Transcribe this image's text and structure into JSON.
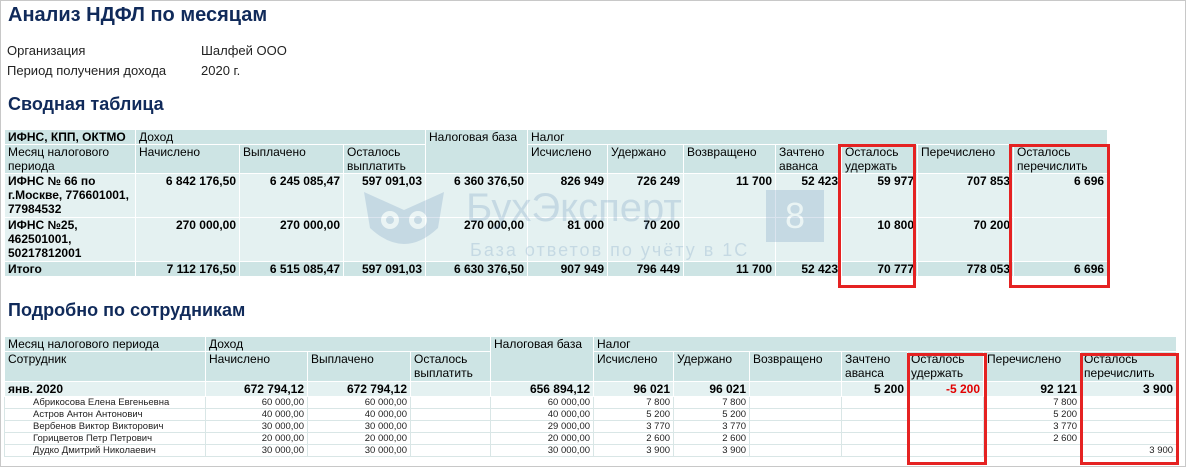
{
  "page": {
    "title": "Анализ НДФЛ по месяцам",
    "org_label": "Организация",
    "org_value": "Шалфей ООО",
    "period_label": "Период получения дохода",
    "period_value": "2020 г."
  },
  "watermark": {
    "title": "БухЭксперт",
    "number": "8",
    "subtitle": "База ответов по учёту в 1С"
  },
  "summary": {
    "heading": "Сводная таблица",
    "h": {
      "group_ifns": "ИФНС, КПП, ОКТМО",
      "group_income": "Доход",
      "tax_base": "Налоговая база",
      "group_tax": "Налог",
      "month": "Месяц налогового периода",
      "accrued": "Начислено",
      "paid": "Выплачено",
      "left_to_pay": "Осталось выплатить",
      "calculated": "Исчислено",
      "withheld": "Удержано",
      "returned": "Возвращено",
      "advance": "Зачтено аванса",
      "left_withhold": "Осталось удержать",
      "transferred": "Перечислено",
      "left_transfer": "Осталось перечислить"
    },
    "rows": [
      {
        "name": "ИФНС № 66 по г.Москве, 776601001, 77984532",
        "accrued": "6 842 176,50",
        "paid": "6 245 085,47",
        "left_to_pay": "597 091,03",
        "tax_base": "6 360 376,50",
        "calculated": "826 949",
        "withheld": "726 249",
        "returned": "11 700",
        "advance": "52 423",
        "left_withhold": "59 977",
        "transferred": "707 853",
        "left_transfer": "6 696"
      },
      {
        "name": "ИФНС №25, 462501001, 50217812001",
        "accrued": "270 000,00",
        "paid": "270 000,00",
        "left_to_pay": "",
        "tax_base": "270 000,00",
        "calculated": "81 000",
        "withheld": "70 200",
        "returned": "",
        "advance": "",
        "left_withhold": "10 800",
        "transferred": "70 200",
        "left_transfer": ""
      }
    ],
    "total": {
      "name": "Итого",
      "accrued": "7 112 176,50",
      "paid": "6 515 085,47",
      "left_to_pay": "597 091,03",
      "tax_base": "6 630 376,50",
      "calculated": "907 949",
      "withheld": "796 449",
      "returned": "11 700",
      "advance": "52 423",
      "left_withhold": "70 777",
      "transferred": "778 053",
      "left_transfer": "6 696"
    }
  },
  "details": {
    "heading": "Подробно по сотрудникам",
    "h": {
      "month": "Месяц налогового периода",
      "group_income": "Доход",
      "tax_base": "Налоговая база",
      "group_tax": "Налог",
      "employee": "Сотрудник",
      "accrued": "Начислено",
      "paid": "Выплачено",
      "left_to_pay": "Осталось выплатить",
      "calculated": "Исчислено",
      "withheld": "Удержано",
      "returned": "Возвращено",
      "advance": "Зачтено аванса",
      "left_withhold": "Осталось удержать",
      "transferred": "Перечислено",
      "left_transfer": "Осталось перечислить"
    },
    "month_row": {
      "name": "янв. 2020",
      "accrued": "672 794,12",
      "paid": "672 794,12",
      "left_to_pay": "",
      "tax_base": "656 894,12",
      "calculated": "96 021",
      "withheld": "96 021",
      "returned": "",
      "advance": "5 200",
      "left_withhold": "-5 200",
      "transferred": "92 121",
      "left_transfer": "3 900"
    },
    "employees": [
      {
        "name": "Абрикосова Елена Евгеньевна",
        "accrued": "60 000,00",
        "paid": "60 000,00",
        "tax_base": "60 000,00",
        "calculated": "7 800",
        "withheld": "7 800",
        "transferred": "7 800",
        "left_transfer": ""
      },
      {
        "name": "Астров Антон Антонович",
        "accrued": "40 000,00",
        "paid": "40 000,00",
        "tax_base": "40 000,00",
        "calculated": "5 200",
        "withheld": "5 200",
        "transferred": "5 200",
        "left_transfer": ""
      },
      {
        "name": "Вербенов Виктор Викторович",
        "accrued": "30 000,00",
        "paid": "30 000,00",
        "tax_base": "29 000,00",
        "calculated": "3 770",
        "withheld": "3 770",
        "transferred": "3 770",
        "left_transfer": ""
      },
      {
        "name": "Горицветов Петр Петрович",
        "accrued": "20 000,00",
        "paid": "20 000,00",
        "tax_base": "20 000,00",
        "calculated": "2 600",
        "withheld": "2 600",
        "transferred": "2 600",
        "left_transfer": ""
      },
      {
        "name": "Дудко Дмитрий Николаевич",
        "accrued": "30 000,00",
        "paid": "30 000,00",
        "tax_base": "30 000,00",
        "calculated": "3 900",
        "withheld": "3 900",
        "transferred": "",
        "left_transfer": "3 900"
      }
    ]
  }
}
